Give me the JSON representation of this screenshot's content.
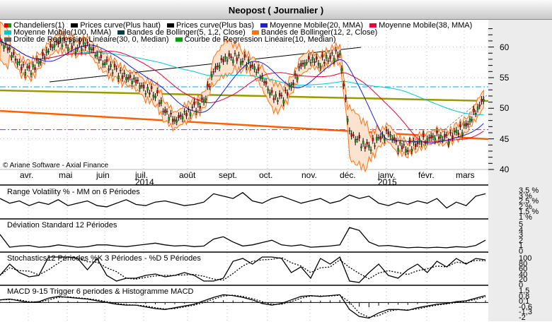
{
  "title": "Neopost  ( Journalier )",
  "legend": [
    {
      "label": "Chandeliers(1)",
      "color": "#e00000"
    },
    {
      "label": "Prices curve(Plus haut)",
      "color": "#000000"
    },
    {
      "label": "Prices curve(Plus bas)",
      "color": "#000000"
    },
    {
      "label": "Moyenne Mobile(20, MMA)",
      "color": "#2020d0"
    },
    {
      "label": "Moyenne Mobile(38, MMA)",
      "color": "#e8003a"
    },
    {
      "label": "Moyenne Mobile(100, MMA)",
      "color": "#00c8d0"
    },
    {
      "label": "Bandes de Bollinger(5, 1,2, Close)",
      "color": "#004040"
    },
    {
      "label": "Bandes de Bollinger(12, 2, Close)",
      "color": "#ff7010"
    },
    {
      "label": "Droite de Regression Linéaire(30, 0, Median)",
      "color": "#606060"
    },
    {
      "label": "Courbe de Regression Linéaire(10, Median)",
      "color": "#00a000"
    }
  ],
  "copyright": "© Ariane Software - Axial Finance",
  "panels": {
    "volatility": {
      "label": "Range Volatility % - MM on 6 Périodes",
      "ticks": [
        "3,5 %",
        "3 %",
        "2,5 %",
        "2 %",
        "1,5 %",
        "1 %"
      ]
    },
    "stddev": {
      "label": "Déviation Standard 12 Périodes",
      "ticks": [
        "5",
        "4",
        "3",
        "2",
        "1",
        "0"
      ]
    },
    "stoch": {
      "label": "Stochastics12 Périodes    %K 3 Périodes  -  %D 5 Périodes",
      "ticks": [
        "100",
        "80",
        "60",
        "40",
        "20",
        "0"
      ]
    },
    "macd": {
      "label": "MACD 9-15   Trigger 6 periodes & Histogramme MACD",
      "ticks": [
        "1,5",
        "0,8",
        "0,1",
        "-0,6",
        "-1,3",
        "-2"
      ]
    }
  },
  "chart_data": {
    "type": "line",
    "title": "Neopost  ( Journalier )",
    "ylim": [
      40,
      64
    ],
    "yticks": [
      "60",
      "55",
      "50",
      "45",
      "40"
    ],
    "xlabels": [
      "avr.",
      "mai",
      "juin",
      "juil.",
      "août",
      "sept.",
      "oct.",
      "nov.",
      "déc.",
      "janv.",
      "févr.",
      "mars"
    ],
    "year_labels": [
      {
        "under": "juil.",
        "text": "2014"
      },
      {
        "under": "janv.",
        "text": "2015"
      }
    ],
    "close_weekly": [
      61,
      59.5,
      57,
      56,
      57.5,
      59.5,
      61,
      60.5,
      60,
      60.5,
      58.5,
      57,
      56,
      55,
      54.5,
      53,
      52.5,
      49.5,
      48,
      49,
      50,
      51,
      56,
      58,
      58.5,
      58,
      57,
      55,
      52,
      51.5,
      53.5,
      57,
      58,
      57.5,
      58.5,
      59,
      46,
      44.5,
      43.5,
      45,
      46,
      44,
      43.5,
      44.5,
      45,
      45.5,
      45,
      46,
      47,
      49.5,
      52
    ],
    "hlines": [
      {
        "value": 53.5,
        "color": "#00a0ff"
      },
      {
        "value": 46.5,
        "color": "#e000e0"
      }
    ],
    "volatility": [
      2.6,
      2.2,
      2.4,
      2.0,
      2.3,
      2.1,
      2.5,
      2.0,
      2.2,
      2.4,
      2.0,
      1.9,
      2.2,
      2.5,
      2.1,
      2.0,
      2.3,
      2.4,
      2.2,
      2.0,
      2.1,
      2.3,
      3.0,
      2.8,
      2.6,
      3.1,
      2.4,
      2.2,
      2.6,
      2.8,
      2.5,
      2.2,
      2.4,
      2.6,
      2.2,
      2.4,
      2.9,
      2.6,
      2.8,
      2.2,
      2.0,
      2.3,
      2.1,
      2.4,
      2.2,
      2.6,
      1.8,
      2.3,
      2.0,
      2.8,
      3.0
    ],
    "stddev": [
      2.8,
      0.6,
      0.8,
      0.9,
      0.6,
      0.7,
      1.0,
      0.8,
      0.6,
      0.7,
      1.0,
      1.0,
      0.8,
      0.7,
      0.9,
      1.1,
      1.3,
      1.0,
      0.8,
      0.9,
      0.7,
      0.8,
      2.0,
      2.4,
      1.5,
      0.8,
      1.0,
      1.4,
      1.8,
      1.0,
      0.8,
      1.0,
      0.6,
      0.7,
      0.8,
      1.0,
      4.0,
      3.5,
      1.5,
      0.8,
      0.9,
      0.7,
      0.5,
      0.6,
      0.5,
      0.6,
      0.5,
      0.7,
      0.6,
      0.9,
      1.8
    ],
    "stoch": [
      30,
      70,
      40,
      25,
      30,
      95,
      95,
      95,
      90,
      50,
      90,
      30,
      10,
      20,
      20,
      30,
      35,
      25,
      30,
      40,
      30,
      10,
      10,
      20,
      80,
      90,
      70,
      95,
      95,
      90,
      40,
      60,
      20,
      90,
      70,
      95,
      10,
      5,
      40,
      70,
      30,
      20,
      50,
      70,
      40,
      80,
      60,
      90,
      70,
      90,
      85
    ],
    "macd": [
      0.3,
      0.4,
      0.2,
      0.0,
      0.1,
      0.5,
      0.7,
      0.6,
      0.5,
      0.4,
      0.2,
      0.0,
      -0.2,
      -0.3,
      -0.3,
      -0.5,
      -0.7,
      -0.8,
      -0.6,
      -0.4,
      -0.2,
      0.2,
      0.6,
      0.9,
      0.8,
      0.6,
      0.3,
      -0.1,
      -0.3,
      -0.1,
      0.3,
      0.7,
      0.8,
      0.7,
      0.8,
      0.9,
      -0.8,
      -1.6,
      -1.8,
      -1.2,
      -0.8,
      -0.8,
      -0.9,
      -0.6,
      -0.4,
      -0.2,
      -0.1,
      0.1,
      0.2,
      0.5,
      0.8
    ]
  }
}
